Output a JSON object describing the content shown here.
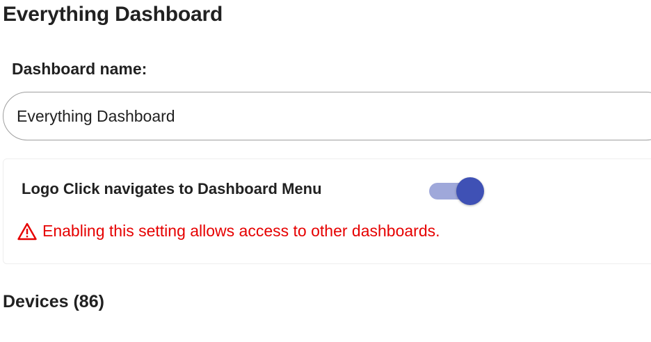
{
  "page": {
    "title": "Everything Dashboard"
  },
  "form": {
    "name_label": "Dashboard name:",
    "name_value": "Everything Dashboard"
  },
  "settings": {
    "logo_click_label": "Logo Click navigates to Dashboard Menu",
    "logo_click_enabled": true,
    "warning_icon": "warning-triangle-icon",
    "warning_text": "Enabling this setting allows access to other dashboards."
  },
  "devices": {
    "heading": "Devices (86)"
  },
  "colors": {
    "accent": "#3f51b5",
    "accent_track": "#9fa8da",
    "warning": "#e60000",
    "text": "#212121"
  }
}
